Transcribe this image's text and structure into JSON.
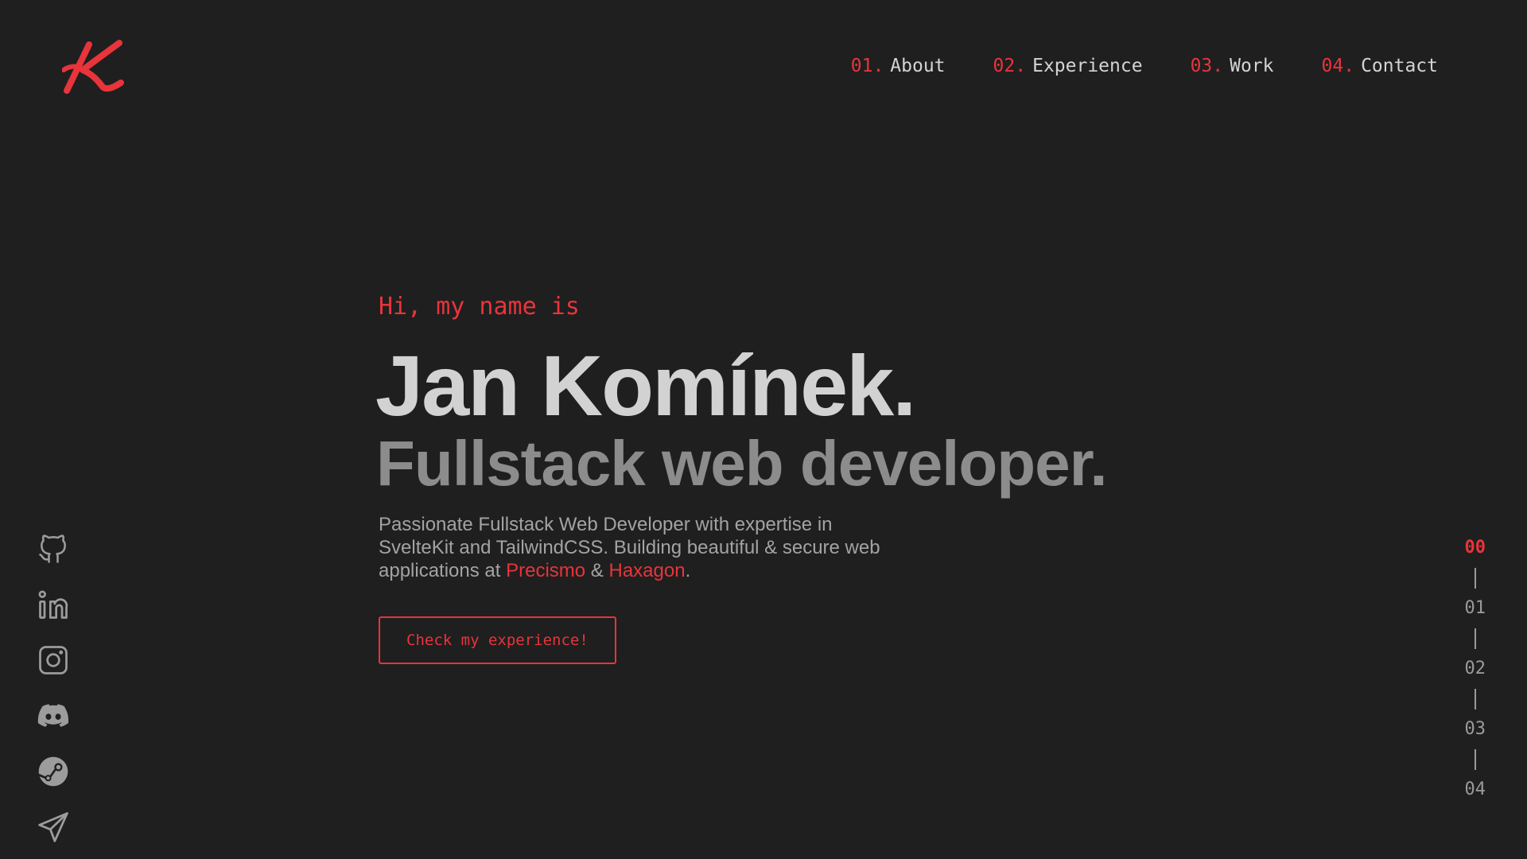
{
  "logo": {
    "icon": "k-monogram-logo",
    "letter": "K",
    "color": "#e8343b"
  },
  "nav": {
    "items": [
      {
        "num": "01.",
        "label": "About"
      },
      {
        "num": "02.",
        "label": "Experience"
      },
      {
        "num": "03.",
        "label": "Work"
      },
      {
        "num": "04.",
        "label": "Contact"
      }
    ]
  },
  "hero": {
    "greeting": "Hi, my name is",
    "name": "Jan Komínek.",
    "role": "Fullstack web developer.",
    "description_part1": "Passionate Fullstack Web Developer with expertise in SvelteKit and TailwindCSS. Building beautiful & secure web applications at ",
    "company1": "Precismo",
    "joiner": " & ",
    "company2": "Haxagon",
    "end": ".",
    "cta_label": "Check my experience!"
  },
  "social": [
    {
      "icon": "github-icon"
    },
    {
      "icon": "linkedin-icon"
    },
    {
      "icon": "instagram-icon"
    },
    {
      "icon": "discord-icon"
    },
    {
      "icon": "steam-icon"
    },
    {
      "icon": "telegram-icon"
    }
  ],
  "sections": {
    "items": [
      "00",
      "01",
      "02",
      "03",
      "04"
    ],
    "active": "00"
  },
  "colors": {
    "accent": "#e8343b",
    "background": "#1f1f1f",
    "text": "#d2d2d2",
    "muted": "#8c8c8c"
  }
}
